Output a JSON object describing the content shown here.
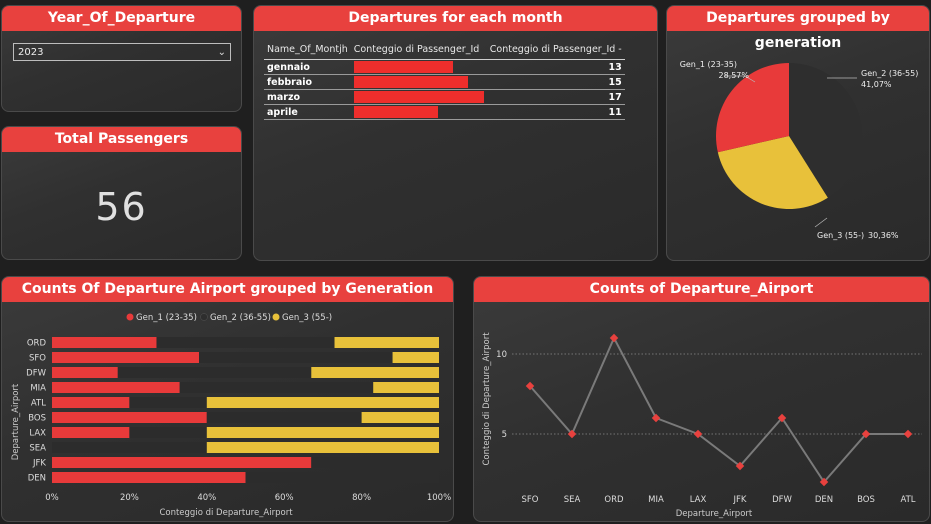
{
  "colors": {
    "accent": "#e8413e",
    "gen1": "#e83a3a",
    "gen2": "#2e2e2e",
    "gen3": "#e8c13a",
    "line": "#7a7a7a",
    "point": "#e8413e"
  },
  "slicer": {
    "title": "Year_Of_Departure",
    "selected": "2023"
  },
  "kpi": {
    "title": "Total Passengers",
    "value": "56"
  },
  "month_table": {
    "title": "Departures for each month",
    "headers": [
      "Name_Of_Montjh",
      "Conteggio di Passenger_Id",
      "Conteggio di Passenger_Id -"
    ],
    "rows": [
      {
        "month": "gennaio",
        "value": 13
      },
      {
        "month": "febbraio",
        "value": 15
      },
      {
        "month": "marzo",
        "value": 17
      },
      {
        "month": "aprile",
        "value": 11
      }
    ]
  },
  "pie": {
    "title": "Departures grouped by generation",
    "slices": [
      {
        "label": "Gen_1 (23-35)",
        "pct": "28,57%",
        "value": 28.57
      },
      {
        "label": "Gen_2 (36-55)",
        "pct": "41,07%",
        "value": 41.07
      },
      {
        "label": "Gen_3 (55-)",
        "pct": "30,36%",
        "value": 30.36
      }
    ]
  },
  "stacked": {
    "title": "Counts Of Departure Airport grouped by Generation",
    "legend": [
      "Gen_1 (23-35)",
      "Gen_2 (36-55)",
      "Gen_3 (55-)"
    ],
    "ylabel": "Departure_Airport",
    "xlabel": "Conteggio di Departure_Airport",
    "xticks": [
      "0%",
      "20%",
      "40%",
      "60%",
      "80%",
      "100%"
    ]
  },
  "line": {
    "title": "Counts of Departure_Airport",
    "ylabel": "Conteggio di Departure_Airport",
    "xlabel": "Departure_Airport",
    "yticks": [
      "5",
      "10"
    ]
  },
  "chart_data": [
    {
      "type": "bar",
      "title": "Departures for each month",
      "categories": [
        "gennaio",
        "febbraio",
        "marzo",
        "aprile"
      ],
      "values": [
        13,
        15,
        17,
        11
      ]
    },
    {
      "type": "pie",
      "title": "Departures grouped by generation",
      "categories": [
        "Gen_1 (23-35)",
        "Gen_2 (36-55)",
        "Gen_3 (55-)"
      ],
      "values": [
        28.57,
        41.07,
        30.36
      ]
    },
    {
      "type": "bar",
      "title": "Counts Of Departure Airport grouped by Generation",
      "stacked": "100%",
      "categories": [
        "ORD",
        "SFO",
        "DFW",
        "MIA",
        "ATL",
        "BOS",
        "LAX",
        "SEA",
        "JFK",
        "DEN"
      ],
      "series": [
        {
          "name": "Gen_1 (23-35)",
          "values": [
            27,
            38,
            17,
            33,
            20,
            40,
            20,
            0,
            67,
            50
          ]
        },
        {
          "name": "Gen_2 (36-55)",
          "values": [
            46,
            50,
            50,
            50,
            20,
            40,
            20,
            40,
            33,
            50
          ]
        },
        {
          "name": "Gen_3 (55-)",
          "values": [
            27,
            12,
            33,
            17,
            60,
            20,
            60,
            60,
            0,
            0
          ]
        }
      ],
      "xlabel": "Conteggio di Departure_Airport",
      "ylabel": "Departure_Airport",
      "xlim": [
        0,
        100
      ]
    },
    {
      "type": "line",
      "title": "Counts of Departure_Airport",
      "categories": [
        "SFO",
        "SEA",
        "ORD",
        "MIA",
        "LAX",
        "JFK",
        "DFW",
        "DEN",
        "BOS",
        "ATL"
      ],
      "values": [
        8,
        5,
        11,
        6,
        5,
        3,
        6,
        2,
        5,
        5
      ],
      "xlabel": "Departure_Airport",
      "ylabel": "Conteggio di Departure_Airport",
      "ylim": [
        1.5,
        12
      ]
    }
  ]
}
